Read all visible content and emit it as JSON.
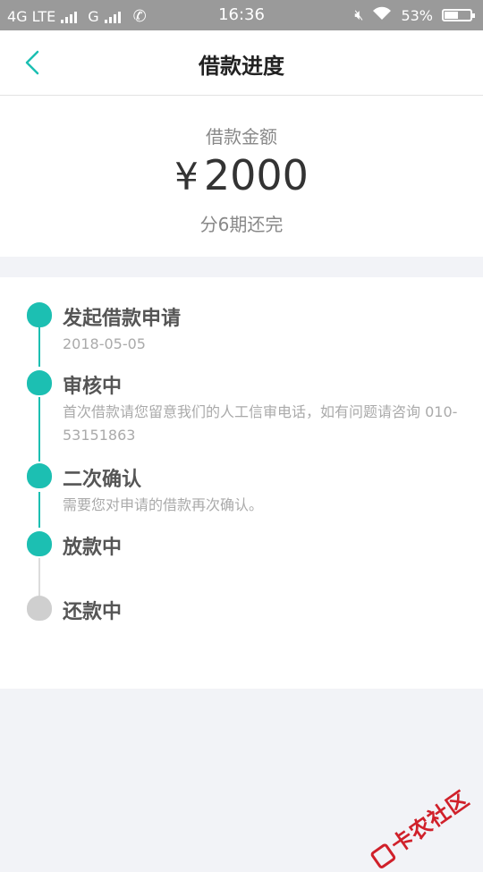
{
  "status_bar": {
    "network1": "4G LTE",
    "network2": "G",
    "time": "16:36",
    "battery": "53%",
    "battery_level": 0.53,
    "icons": [
      "signal-icon",
      "call-icon",
      "mute-icon",
      "wifi-icon",
      "battery-icon"
    ]
  },
  "header": {
    "title": "借款进度",
    "back_icon": "chevron-left-icon"
  },
  "amount": {
    "label": "借款金额",
    "currency": "¥",
    "value": "2000",
    "installments": "分6期还完"
  },
  "steps": [
    {
      "title": "发起借款申请",
      "desc": "2018-05-05",
      "active": true
    },
    {
      "title": "审核中",
      "desc": "首次借款请您留意我们的人工信审电话，如有问题请咨询 010-53151863",
      "active": true
    },
    {
      "title": "二次确认",
      "desc": "需要您对申请的借款再次确认。",
      "active": true
    },
    {
      "title": "放款中",
      "desc": "",
      "active": true
    },
    {
      "title": "还款中",
      "desc": "",
      "active": false
    }
  ],
  "colors": {
    "accent": "#1cbfb2",
    "inactive": "#cfcfcf",
    "watermark": "#d0202a"
  },
  "watermark": {
    "text": "卡农社区"
  }
}
